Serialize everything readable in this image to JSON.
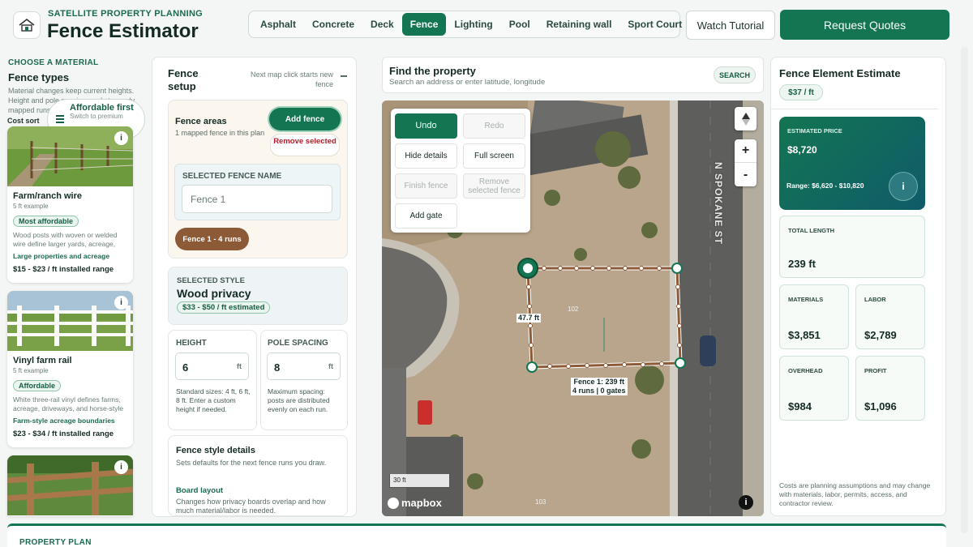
{
  "header": {
    "brand_subtitle": "SATELLITE PROPERTY PLANNING",
    "brand_title": "Fence Estimator",
    "tabs": [
      "Asphalt",
      "Concrete",
      "Deck",
      "Fence",
      "Lighting",
      "Pool",
      "Retaining wall",
      "Sport Court"
    ],
    "active_tab": "Fence",
    "tutorial_label": "Watch Tutorial",
    "quotes_label": "Request Quotes"
  },
  "materials": {
    "eyebrow": "CHOOSE A MATERIAL",
    "title": "Fence types",
    "description": "Material changes keep current heights. Height and pole spacing apply to newly mapped runs.",
    "cost_sort_label": "Cost sort",
    "sort_title": "Affordable first",
    "sort_sub": "Switch to premium",
    "cards": [
      {
        "name": "Farm/ranch wire",
        "example": "5 ft example",
        "badge": "Most affordable",
        "description": "Wood posts with woven or welded wire define larger yards, acreage, and pastures.",
        "use": "Large properties and acreage",
        "price": "$15 - $23 / ft installed range"
      },
      {
        "name": "Vinyl farm rail",
        "example": "5 ft example",
        "badge": "Affordable",
        "description": "White three-rail vinyl defines farms, acreage, driveways, and horse-style boundaries.",
        "use": "Farm-style acreage boundaries",
        "price": "$23 - $34 / ft installed range"
      },
      {
        "name": "",
        "example": "",
        "badge": "",
        "description": "",
        "use": "",
        "price": ""
      }
    ]
  },
  "setup": {
    "title": "Fence setup",
    "note": "Next map click starts new fence",
    "areas_title": "Fence areas",
    "areas_sub": "1 mapped fence in this plan",
    "add_label": "Add fence",
    "remove_label": "Remove selected",
    "name_label": "SELECTED FENCE NAME",
    "name_value": "Fence 1",
    "fence_chip": "Fence 1 - 4 runs",
    "style_eyebrow": "SELECTED STYLE",
    "style_name": "Wood privacy",
    "style_price": "$33 - $50 / ft estimated",
    "height_label": "HEIGHT",
    "height_value": "6",
    "height_unit": "ft",
    "height_help": "Standard sizes: 4 ft, 6 ft, 8 ft. Enter a custom height if needed.",
    "spacing_label": "POLE SPACING",
    "spacing_value": "8",
    "spacing_unit": "ft",
    "spacing_help": "Maximum spacing: posts are distributed evenly on each run.",
    "details_title": "Fence style details",
    "details_sub": "Sets defaults for the next fence runs you draw.",
    "board_title": "Board layout",
    "board_sub": "Changes how privacy boards overlap and how much material/labor is needed."
  },
  "map": {
    "find_title": "Find the property",
    "find_sub": "Search an address or enter latitude, longitude",
    "search_label": "SEARCH",
    "tools": {
      "undo": "Undo",
      "redo": "Redo",
      "hide_details": "Hide details",
      "full_screen": "Full screen",
      "finish_fence": "Finish fence",
      "remove_selected_fence": "Remove selected fence",
      "add_gate": "Add gate"
    },
    "zoom_in": "+",
    "zoom_out": "-",
    "street_name": "N SPOKANE ST",
    "side_label": "47.7 ft",
    "lot_number": "102",
    "lot_number_bottom": "103",
    "fence_label_line1": "Fence 1: 239 ft",
    "fence_label_line2": "4 runs | 0 gates",
    "scale_label": "30 ft",
    "attribution": "mapbox",
    "info_glyph": "i"
  },
  "estimate": {
    "title": "Fence Element Estimate",
    "rate": "$37 / ft",
    "price_eyebrow": "ESTIMATED PRICE",
    "price_value": "$8,720",
    "range": "Range: $6,620 - $10,820",
    "total_length_label": "TOTAL LENGTH",
    "total_length_value": "239 ft",
    "materials_label": "MATERIALS",
    "materials_value": "$3,851",
    "labor_label": "LABOR",
    "labor_value": "$2,789",
    "overhead_label": "OVERHEAD",
    "overhead_value": "$984",
    "profit_label": "PROFIT",
    "profit_value": "$1,096",
    "note": "Costs are planning assumptions and may change with materials, labor, permits, access, and contractor review."
  },
  "bottom": {
    "eyebrow": "PROPERTY PLAN"
  },
  "colors": {
    "accent": "#137552",
    "fence_run": "#8d5a38",
    "remove": "#b21e2c"
  }
}
